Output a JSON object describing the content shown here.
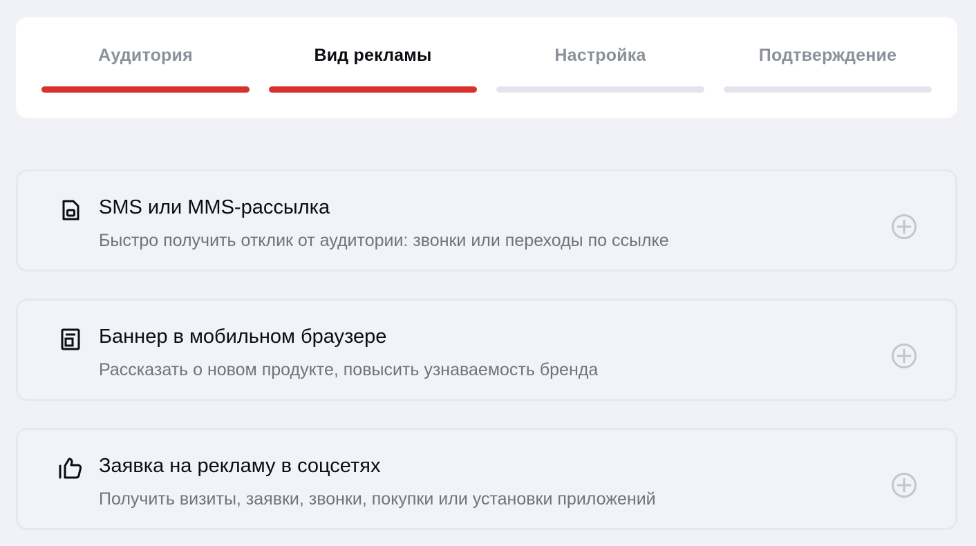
{
  "stepper": {
    "steps": [
      {
        "label": "Аудитория",
        "state": "done"
      },
      {
        "label": "Вид рекламы",
        "state": "current"
      },
      {
        "label": "Настройка",
        "state": "pending"
      },
      {
        "label": "Подтверждение",
        "state": "pending"
      }
    ],
    "colors": {
      "active_bar": "#d8312e",
      "inactive_bar": "#e4e5ec",
      "active_text": "#0b0d12",
      "inactive_text": "#8c9199"
    }
  },
  "options": [
    {
      "icon": "sim-card-icon",
      "title": "SMS или MMS-рассылка",
      "description": "Быстро получить отклик от аудитории: звонки или переходы по ссылке",
      "action_icon": "plus-circle-icon"
    },
    {
      "icon": "banner-icon",
      "title": "Баннер в мобильном браузере",
      "description": "Рассказать о новом продукте, повысить узнаваемость бренда",
      "action_icon": "plus-circle-icon"
    },
    {
      "icon": "thumbs-up-icon",
      "title": "Заявка на рекламу в соцсетях",
      "description": "Получить визиты, заявки, звонки, покупки или установки приложений",
      "action_icon": "plus-circle-icon"
    }
  ]
}
